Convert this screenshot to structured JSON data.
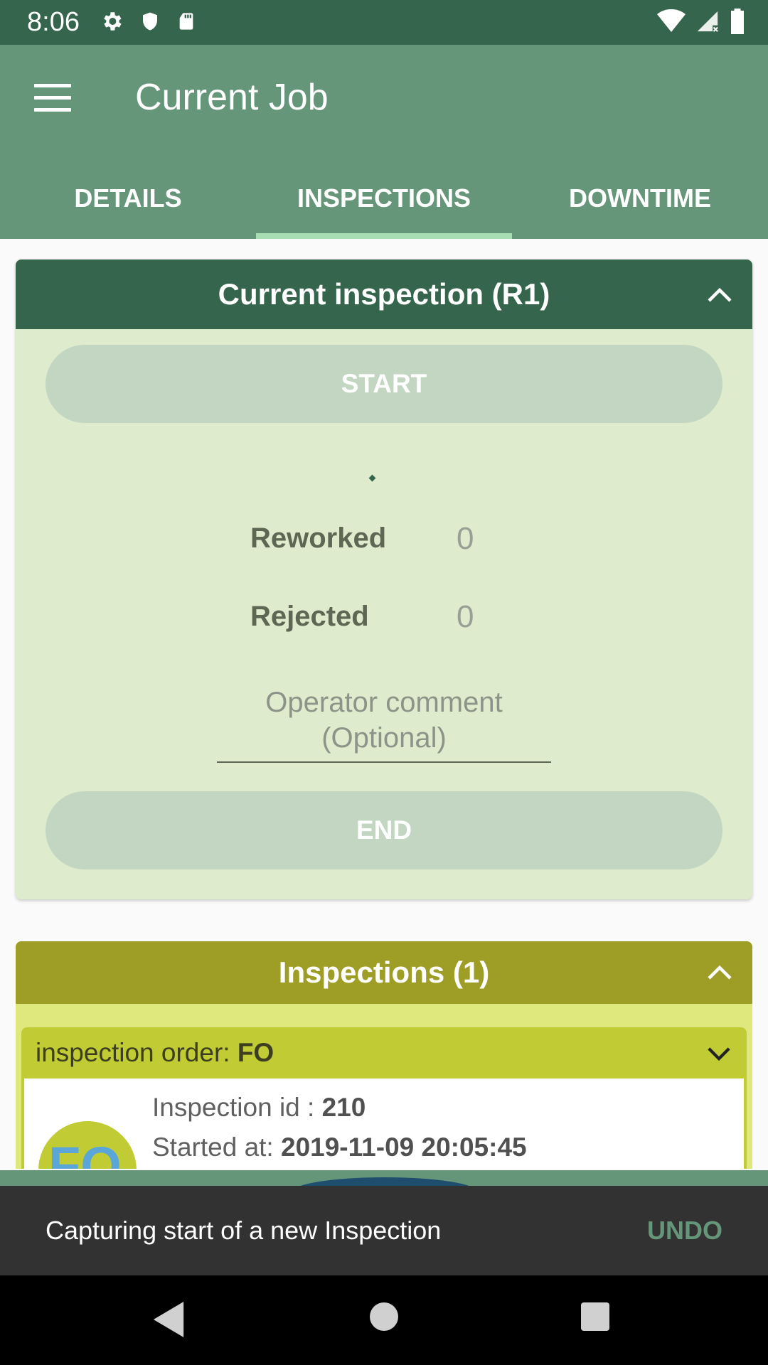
{
  "status_bar": {
    "time": "8:06",
    "icons_left": [
      "gear-icon",
      "shield-icon",
      "sd-card-icon"
    ],
    "icons_right": [
      "wifi-icon",
      "cell-signal-icon",
      "battery-icon"
    ]
  },
  "app_bar": {
    "title": "Current Job",
    "menu_icon": "menu-icon"
  },
  "tabs": [
    {
      "label": "DETAILS",
      "active": false
    },
    {
      "label": "INSPECTIONS",
      "active": true
    },
    {
      "label": "DOWNTIME",
      "active": false
    }
  ],
  "current_inspection": {
    "title": "Current inspection (R1)",
    "start_label": "START",
    "reworked_label": "Reworked",
    "reworked_value": "0",
    "rejected_label": "Rejected",
    "rejected_value": "0",
    "comment_placeholder": "Operator comment (Optional)",
    "end_label": "END"
  },
  "inspections": {
    "title": "Inspections (1)",
    "order_label": "inspection order: ",
    "order_value": "FO",
    "avatar_text": "FO",
    "id_label": "Inspection id : ",
    "id_value": "210",
    "started_label": "Started at: ",
    "started_value": "2019-11-09 20:05:45"
  },
  "snackbar": {
    "message": "Capturing start of a new Inspection",
    "action": "UNDO"
  },
  "colors": {
    "status_bar": "#35654c",
    "app_bar": "#66967a",
    "tab_indicator": "#a8dcb2",
    "card1_header": "#35654c",
    "card1_body": "#deeccd",
    "card2_header": "#9e9e26",
    "card2_body": "#dee87c",
    "sub_card": "#c1cc34"
  }
}
